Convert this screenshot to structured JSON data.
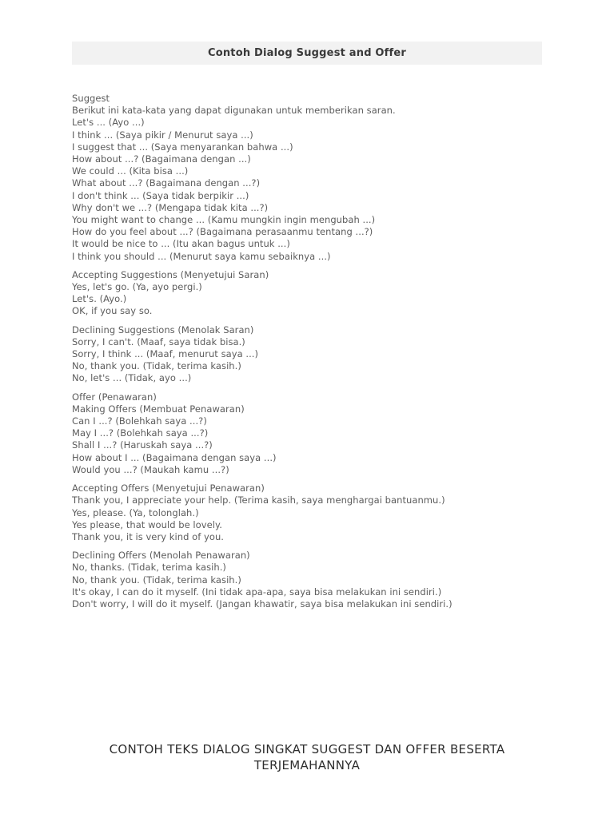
{
  "header": {
    "title": "Contoh Dialog Suggest and Offer",
    "band_color": "#f2f2f2",
    "text_color": "#3a3a3a"
  },
  "body": {
    "text_color": "#5c5c5c",
    "blocks": [
      {
        "name": "suggest-section",
        "lines": [
          "Suggest",
          "Berikut ini kata-kata yang dapat digunakan untuk memberikan saran.",
          "Let's ... (Ayo ...)",
          "I think ... (Saya pikir / Menurut saya ...)",
          "I suggest that ... (Saya menyarankan bahwa ...)",
          "How about ...? (Bagaimana dengan ...)",
          "We could ... (Kita bisa ...)",
          "What about ...? (Bagaimana dengan ...?)",
          "I don't think ... (Saya tidak berpikir ...)",
          "Why don't we ...? (Mengapa tidak kita ...?)",
          "You might want to change ... (Kamu mungkin ingin mengubah ...)",
          "How do you feel about ...? (Bagaimana perasaanmu tentang ...?)",
          "It would be nice to ... (Itu akan bagus untuk ...)",
          "I think you should ... (Menurut saya kamu sebaiknya ...)"
        ]
      },
      {
        "name": "accepting-suggestions-section",
        "lines": [
          "Accepting Suggestions (Menyetujui Saran)",
          "Yes, let's go. (Ya, ayo pergi.)",
          "Let's. (Ayo.)",
          "OK, if you say so."
        ]
      },
      {
        "name": "declining-suggestions-section",
        "lines": [
          "Declining Suggestions (Menolak Saran)",
          "Sorry, I can't. (Maaf, saya tidak bisa.)",
          "Sorry, I think ... (Maaf, menurut saya ...)",
          "No, thank you. (Tidak, terima kasih.)",
          "No, let's ... (Tidak, ayo ...)"
        ]
      },
      {
        "name": "offer-section",
        "lines": [
          "Offer (Penawaran)",
          "Making Offers (Membuat Penawaran)",
          "Can I ...? (Bolehkah saya ...?)",
          "May I ...? (Bolehkah saya ...?)",
          "Shall I ...? (Haruskah saya ...?)",
          "How about I ... (Bagaimana dengan saya ...)",
          "Would you ...? (Maukah kamu ...?)"
        ]
      },
      {
        "name": "accepting-offers-section",
        "lines": [
          "Accepting Offers (Menyetujui Penawaran)",
          "Thank you, I appreciate your help. (Terima kasih, saya menghargai bantuanmu.)",
          "Yes, please. (Ya, tolonglah.)",
          "Yes please, that would be lovely.",
          "Thank you, it is very kind of you."
        ]
      },
      {
        "name": "declining-offers-section",
        "lines": [
          "Declining Offers (Menolah Penawaran)",
          "No, thanks. (Tidak, terima kasih.)",
          "No, thank you. (Tidak, terima kasih.)",
          "It's okay, I can do it myself. (Ini tidak apa-apa, saya bisa melakukan ini sendiri.)",
          "Don't worry, I will do it myself. (Jangan khawatir, saya bisa melakukan ini sendiri.)"
        ]
      }
    ]
  },
  "caption": {
    "lines": [
      "CONTOH TEKS DIALOG SINGKAT SUGGEST DAN OFFER BESERTA",
      "TERJEMAHANNYA"
    ],
    "text_color": "#2e2e2e"
  }
}
